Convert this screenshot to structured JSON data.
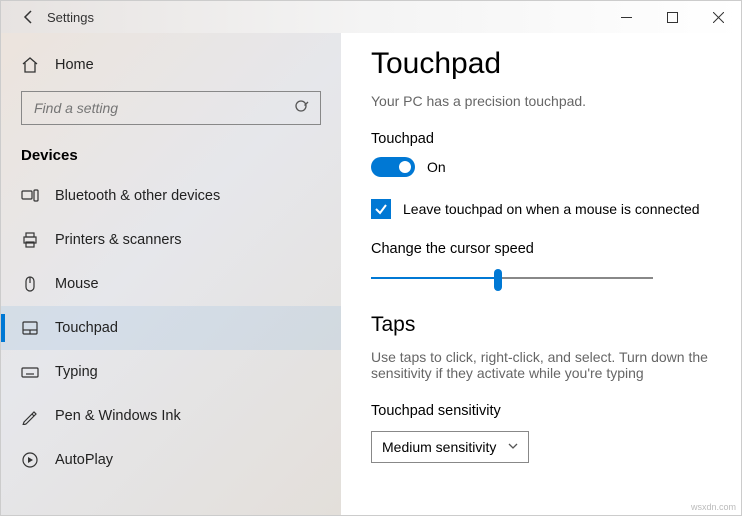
{
  "titlebar": {
    "title": "Settings"
  },
  "sidebar": {
    "home_label": "Home",
    "search_placeholder": "Find a setting",
    "section_header": "Devices",
    "items": [
      {
        "label": "Bluetooth & other devices"
      },
      {
        "label": "Printers & scanners"
      },
      {
        "label": "Mouse"
      },
      {
        "label": "Touchpad"
      },
      {
        "label": "Typing"
      },
      {
        "label": "Pen & Windows Ink"
      },
      {
        "label": "AutoPlay"
      }
    ]
  },
  "content": {
    "page_title": "Touchpad",
    "precision_text": "Your PC has a precision touchpad.",
    "touchpad_label": "Touchpad",
    "toggle_state_label": "On",
    "checkbox_label": "Leave touchpad on when a mouse is connected",
    "cursor_speed_label": "Change the cursor speed",
    "taps_title": "Taps",
    "taps_desc": "Use taps to click, right-click, and select. Turn down the sensitivity if they activate while you're typing",
    "sensitivity_label": "Touchpad sensitivity",
    "sensitivity_value": "Medium sensitivity"
  },
  "watermark": "wsxdn.com"
}
